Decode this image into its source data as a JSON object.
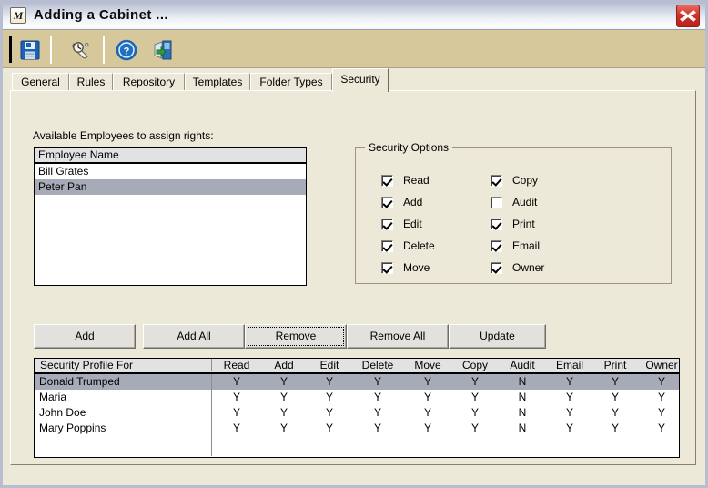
{
  "window": {
    "title": "Adding a Cabinet ...",
    "app_icon_letter": "M",
    "close_label": "×"
  },
  "toolbar": {
    "items": [
      {
        "name": "save-icon",
        "tooltip": "Save"
      },
      {
        "name": "history-icon",
        "tooltip": "History"
      },
      {
        "name": "help-icon",
        "tooltip": "Help"
      },
      {
        "name": "exit-icon",
        "tooltip": "Exit"
      }
    ]
  },
  "tabs": [
    {
      "label": "General",
      "active": false
    },
    {
      "label": "Rules",
      "active": false
    },
    {
      "label": "Repository",
      "active": false
    },
    {
      "label": "Templates",
      "active": false
    },
    {
      "label": "Folder Types",
      "active": false
    },
    {
      "label": "Security",
      "active": true
    }
  ],
  "available": {
    "label": "Available Employees to assign rights:",
    "column_header": "Employee Name",
    "rows": [
      {
        "name": "Bill Grates",
        "selected": false
      },
      {
        "name": "Peter Pan",
        "selected": true
      }
    ]
  },
  "security_options": {
    "title": "Security Options",
    "left_column": [
      {
        "label": "Read",
        "checked": true
      },
      {
        "label": "Add",
        "checked": true
      },
      {
        "label": "Edit",
        "checked": true
      },
      {
        "label": "Delete",
        "checked": true
      },
      {
        "label": "Move",
        "checked": true
      }
    ],
    "right_column": [
      {
        "label": "Copy",
        "checked": true
      },
      {
        "label": "Audit",
        "checked": false
      },
      {
        "label": "Print",
        "checked": true
      },
      {
        "label": "Email",
        "checked": true
      },
      {
        "label": "Owner",
        "checked": true
      }
    ]
  },
  "buttons": [
    {
      "label": "Add",
      "focused": false
    },
    {
      "label": "Add All",
      "focused": false
    },
    {
      "label": "Remove",
      "focused": true
    },
    {
      "label": "Remove All",
      "focused": false
    },
    {
      "label": "Update",
      "focused": false
    }
  ],
  "profile_grid": {
    "columns": [
      "Security Profile For",
      "Read",
      "Add",
      "Edit",
      "Delete",
      "Move",
      "Copy",
      "Audit",
      "Email",
      "Print",
      "Owner"
    ],
    "rows": [
      {
        "cells": [
          "Donald Trumped",
          "Y",
          "Y",
          "Y",
          "Y",
          "Y",
          "Y",
          "N",
          "Y",
          "Y",
          "Y"
        ],
        "selected": true
      },
      {
        "cells": [
          "Maria",
          "Y",
          "Y",
          "Y",
          "Y",
          "Y",
          "Y",
          "N",
          "Y",
          "Y",
          "Y"
        ],
        "selected": false
      },
      {
        "cells": [
          "John Doe",
          "Y",
          "Y",
          "Y",
          "Y",
          "Y",
          "Y",
          "N",
          "Y",
          "Y",
          "Y"
        ],
        "selected": false
      },
      {
        "cells": [
          "Mary Poppins",
          "Y",
          "Y",
          "Y",
          "Y",
          "Y",
          "Y",
          "N",
          "Y",
          "Y",
          "Y"
        ],
        "selected": false
      }
    ]
  },
  "colors": {
    "window_face": "#ece9d8",
    "toolbar": "#d6c89a",
    "selection": "#a7abb7",
    "close_red": "#d0352c",
    "frame": "#b8bed0"
  }
}
